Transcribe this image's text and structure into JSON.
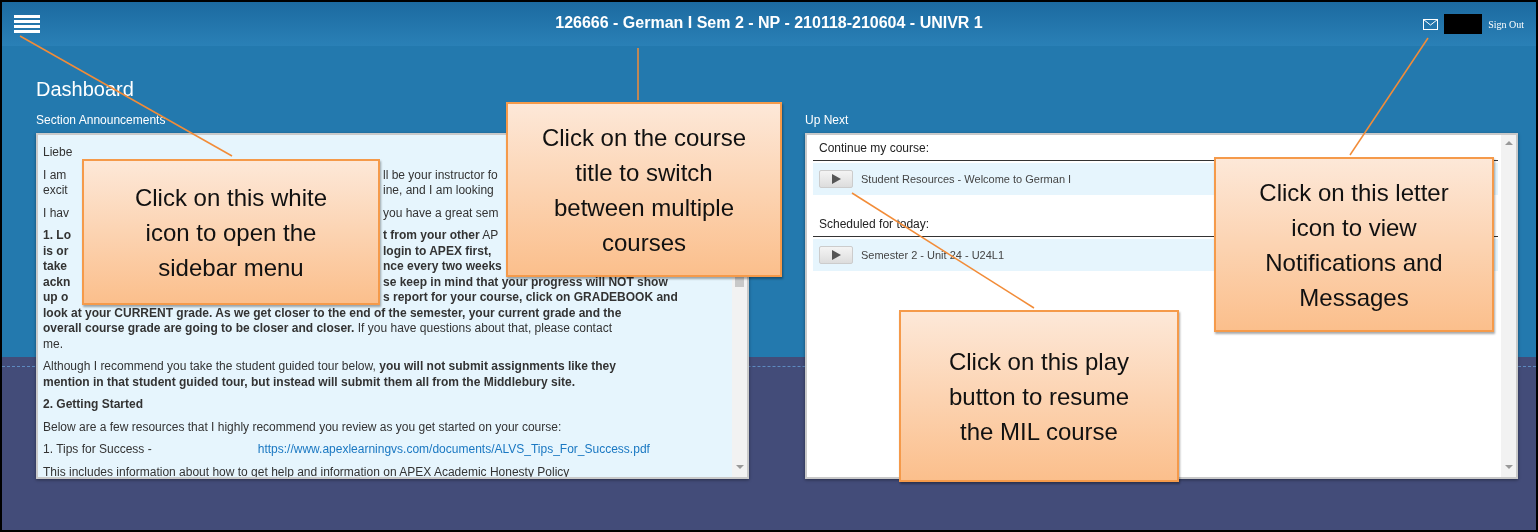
{
  "header": {
    "course_title": "126666 - German I Sem 2 - NP - 210118-210604 - UNIVR 1",
    "sign_out": "Sign Out"
  },
  "page_title": "Dashboard",
  "announcements": {
    "label": "Section Announcements",
    "paragraphs": [
      {
        "lines": [
          {
            "kind": "split",
            "left": "Liebe"
          }
        ]
      },
      {
        "lines": [
          {
            "kind": "split",
            "left": "I am",
            "right": "ll be your instructor fo"
          },
          {
            "kind": "split",
            "left": "excit",
            "right": "ine, and I am looking"
          }
        ]
      },
      {
        "lines": [
          {
            "kind": "split",
            "left": "I hav",
            "right": "you have a great sem"
          }
        ]
      },
      {
        "lines": [
          {
            "kind": "split",
            "left": "**1. Lo**",
            "right": "**t from your other** AP"
          },
          {
            "kind": "split",
            "left": "**is or**",
            "right": "**login to APEX first,**"
          },
          {
            "kind": "split",
            "left": "**take**",
            "right": "**nce every two weeks**"
          },
          {
            "kind": "split",
            "left": "**ackn**",
            "right": "**se keep in mind that your progress will NOT show**"
          },
          {
            "kind": "split",
            "left": "**up o**",
            "right": "**s report for your course, click on GRADEBOOK and**"
          },
          {
            "kind": "full",
            "text": "**look at your CURRENT grade. As we get closer to the end of the semester, your current grade and the**"
          },
          {
            "kind": "full",
            "text": "**overall course grade are going to be closer and closer.** If you have questions about that, please contact"
          },
          {
            "kind": "full",
            "text": "me."
          }
        ]
      },
      {
        "lines": [
          {
            "kind": "full",
            "text": "Although I recommend you take the student guided tour below, **you will not submit assignments like they**"
          },
          {
            "kind": "full",
            "text": "**mention in that student guided tour, but instead will submit them all from the Middlebury site.**"
          }
        ]
      },
      {
        "lines": [
          {
            "kind": "full",
            "text": "**2. Getting Started**"
          }
        ]
      },
      {
        "lines": [
          {
            "kind": "full",
            "text": "Below are a few resources that I highly recommend you review as you get started on your course:"
          }
        ]
      },
      {
        "lines": [
          {
            "kind": "link",
            "text": "1.  Tips for Success -",
            "link": "https://www.apexlearningvs.com/documents/ALVS_Tips_For_Success.pdf"
          }
        ]
      },
      {
        "lines": [
          {
            "kind": "full",
            "text": "This includes information about how to get help and information on APEX Academic Honesty Policy"
          }
        ]
      }
    ]
  },
  "up_next": {
    "label": "Up Next",
    "sections": [
      {
        "heading": "Continue my course:",
        "items": [
          {
            "title": "Student Resources - Welcome to German I"
          }
        ]
      },
      {
        "heading": "Scheduled for today:",
        "items": [
          {
            "title": "Semester 2 - Unit 24 - U24L1"
          }
        ]
      }
    ]
  },
  "callouts": [
    {
      "text": "Click on this white icon to open the sidebar menu"
    },
    {
      "text": "Click on the course title to switch between multiple courses"
    },
    {
      "text": "Click on this letter icon to view Notifications and Messages"
    },
    {
      "text": "Click on this play button to resume the MIL course"
    }
  ]
}
